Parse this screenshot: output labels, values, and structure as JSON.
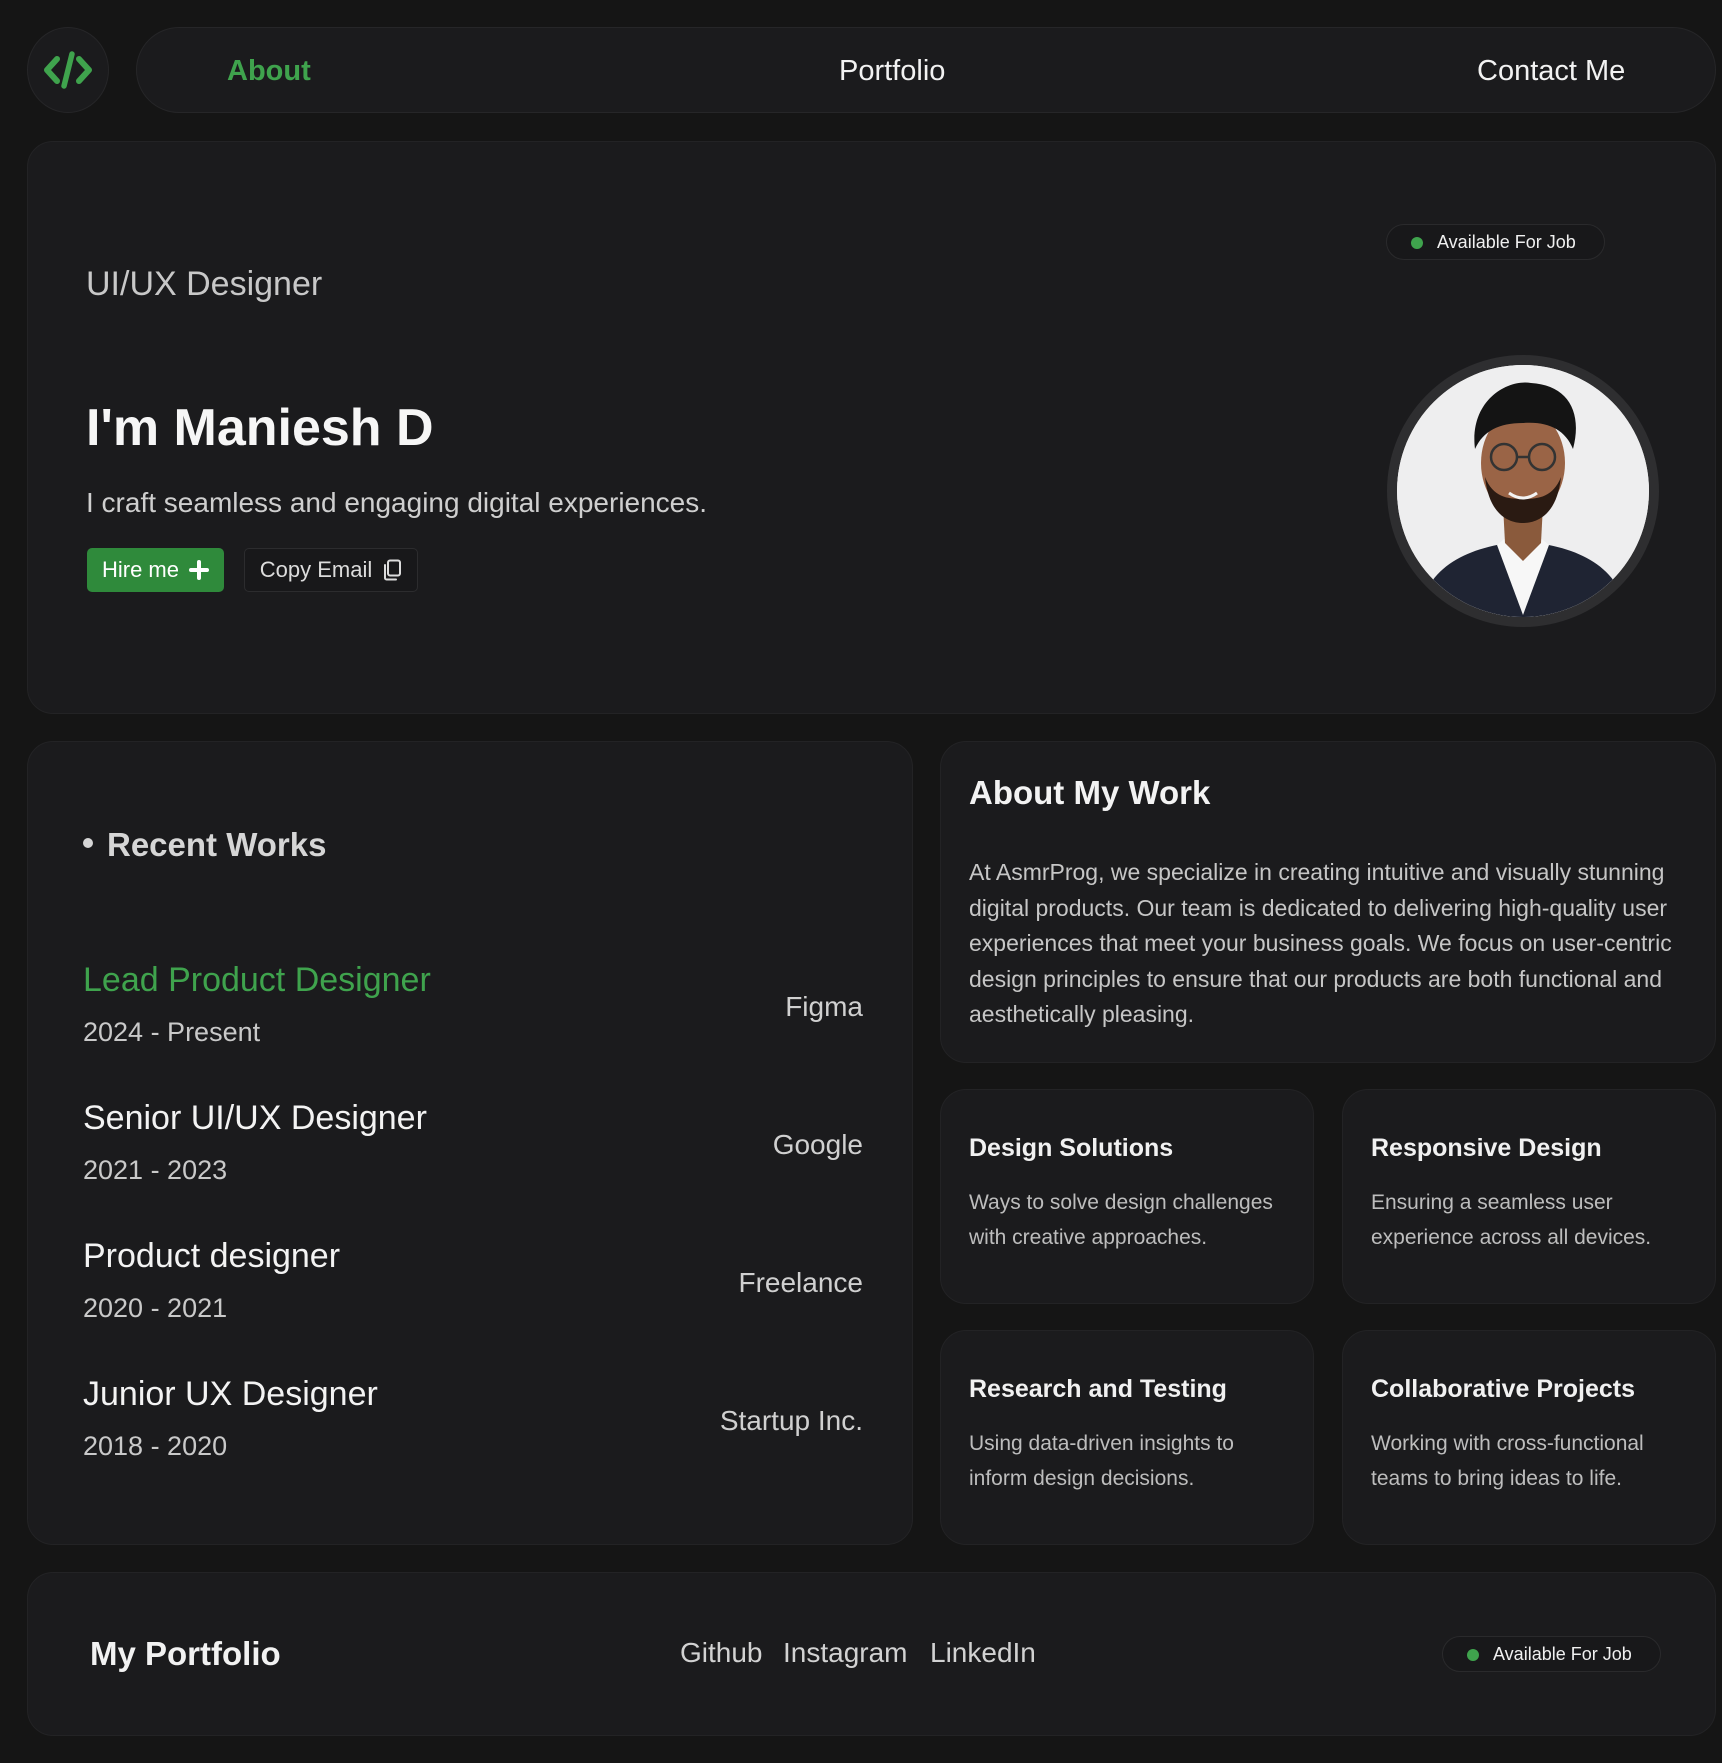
{
  "nav": {
    "logo_icon": "code-brackets-icon",
    "items": [
      "About",
      "Portfolio",
      "Contact Me"
    ],
    "active": "About",
    "accent": "#3fa34d"
  },
  "hero": {
    "status": "Available For Job",
    "role": "UI/UX Designer",
    "greeting": "I'm Maniesh D",
    "tagline": "I craft seamless and engaging digital experiences.",
    "hire_label": "Hire me",
    "copy_label": "Copy Email"
  },
  "works": {
    "title": "Recent Works",
    "jobs": [
      {
        "title": "Lead Product Designer",
        "dates": "2024 - Present",
        "company": "Figma"
      },
      {
        "title": "Senior UI/UX Designer",
        "dates": "2021 - 2023",
        "company": "Google"
      },
      {
        "title": "Product designer",
        "dates": "2020 - 2021",
        "company": "Freelance"
      },
      {
        "title": "Junior UX Designer",
        "dates": "2018 - 2020",
        "company": "Startup Inc."
      }
    ]
  },
  "about": {
    "title": "About My Work",
    "body": "At AsmrProg, we specialize in creating intuitive and visually stunning digital products. Our team is dedicated to delivering high-quality user experiences that meet your business goals. We focus on user-centric design principles to ensure that our products are both functional and aesthetically pleasing."
  },
  "features": [
    {
      "title": "Design Solutions",
      "desc": "Ways to solve design challenges with creative approaches."
    },
    {
      "title": "Responsive Design",
      "desc": "Ensuring a seamless user experience across all devices."
    },
    {
      "title": "Research and Testing",
      "desc": "Using data-driven insights to inform design decisions."
    },
    {
      "title": "Collaborative Projects",
      "desc": "Working with cross-functional teams to bring ideas to life."
    }
  ],
  "footer": {
    "title": "My Portfolio",
    "links": [
      "Github",
      "Instagram",
      "LinkedIn"
    ],
    "status": "Available For Job"
  }
}
